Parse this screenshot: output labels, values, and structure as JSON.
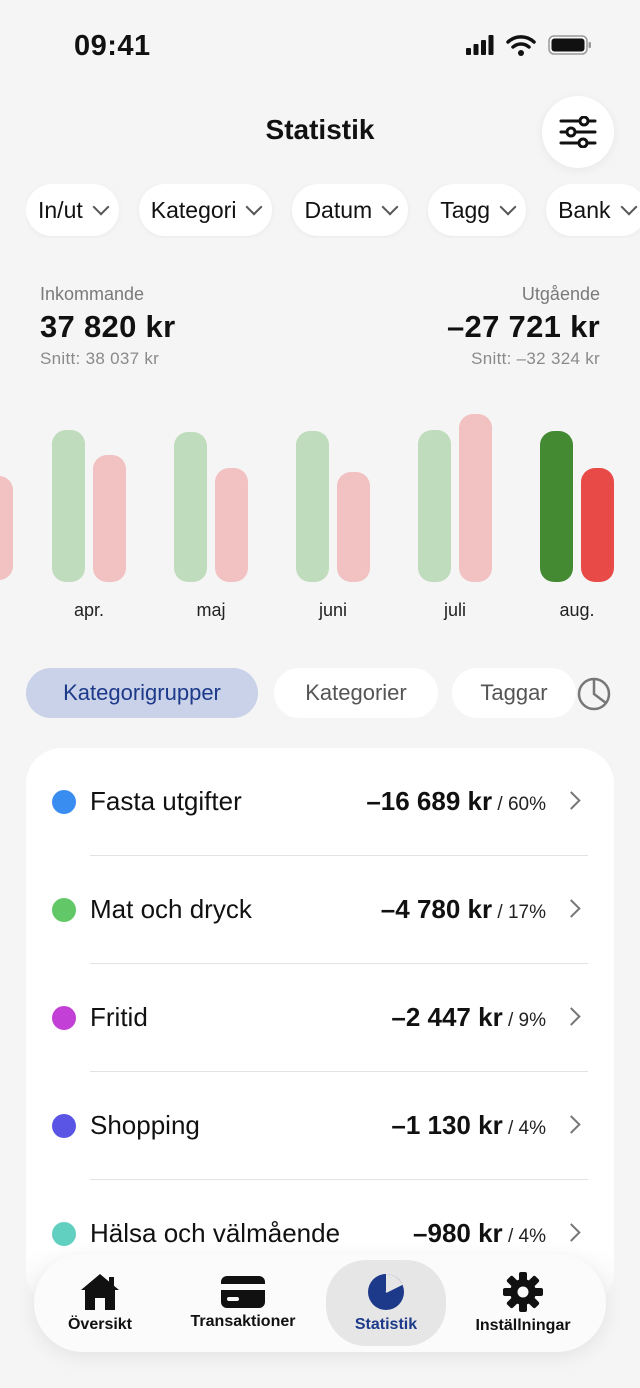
{
  "status_bar": {
    "time": "09:41"
  },
  "header": {
    "title": "Statistik"
  },
  "filters": [
    {
      "label": "In/ut"
    },
    {
      "label": "Kategori"
    },
    {
      "label": "Datum"
    },
    {
      "label": "Tagg"
    },
    {
      "label": "Bank"
    }
  ],
  "summary": {
    "incoming_label": "Inkommande",
    "incoming_value": "37 820 kr",
    "incoming_avg": "Snitt: 38 037 kr",
    "outgoing_label": "Utgående",
    "outgoing_value": "–27 721 kr",
    "outgoing_avg": "Snitt: –32 324 kr"
  },
  "chart_data": {
    "type": "bar",
    "categories": [
      "apr.",
      "maj",
      "juni",
      "juli",
      "aug."
    ],
    "series": [
      {
        "values": [
          37000,
          36500,
          36800,
          37100,
          36900
        ]
      },
      {
        "values": [
          31000,
          27700,
          26800,
          41000,
          27721
        ]
      }
    ],
    "selected_category": "aug.",
    "colors": {
      "income": "#bfdcbc",
      "income_selected": "#448a33",
      "expense": "#f2c1c1",
      "expense_selected": "#e84b47"
    }
  },
  "segments": {
    "tabs": [
      "Kategorigrupper",
      "Kategorier",
      "Taggar"
    ],
    "active": "Kategorigrupper",
    "toggle_icon": "pie-chart-icon"
  },
  "categories_list": [
    {
      "name": "Fasta utgifter",
      "amount": "–16 689 kr",
      "percent": " / 60%",
      "color": "#3a8df0"
    },
    {
      "name": "Mat och dryck",
      "amount": "–4 780 kr",
      "percent": " / 17%",
      "color": "#62c766"
    },
    {
      "name": "Fritid",
      "amount": "–2 447 kr",
      "percent": " / 9%",
      "color": "#c240d6"
    },
    {
      "name": "Shopping",
      "amount": "–1 130 kr",
      "percent": " / 4%",
      "color": "#5b55e6"
    },
    {
      "name": "Hälsa och välmående",
      "amount": "–980 kr",
      "percent": " / 4%",
      "color": "#62d0c0"
    }
  ],
  "tabbar": {
    "items": [
      {
        "label": "Översikt",
        "icon": "home-icon"
      },
      {
        "label": "Transaktioner",
        "icon": "card-icon"
      },
      {
        "label": "Statistik",
        "icon": "pie-chart-icon"
      },
      {
        "label": "Inställningar",
        "icon": "gear-icon"
      }
    ],
    "active": "Statistik"
  }
}
